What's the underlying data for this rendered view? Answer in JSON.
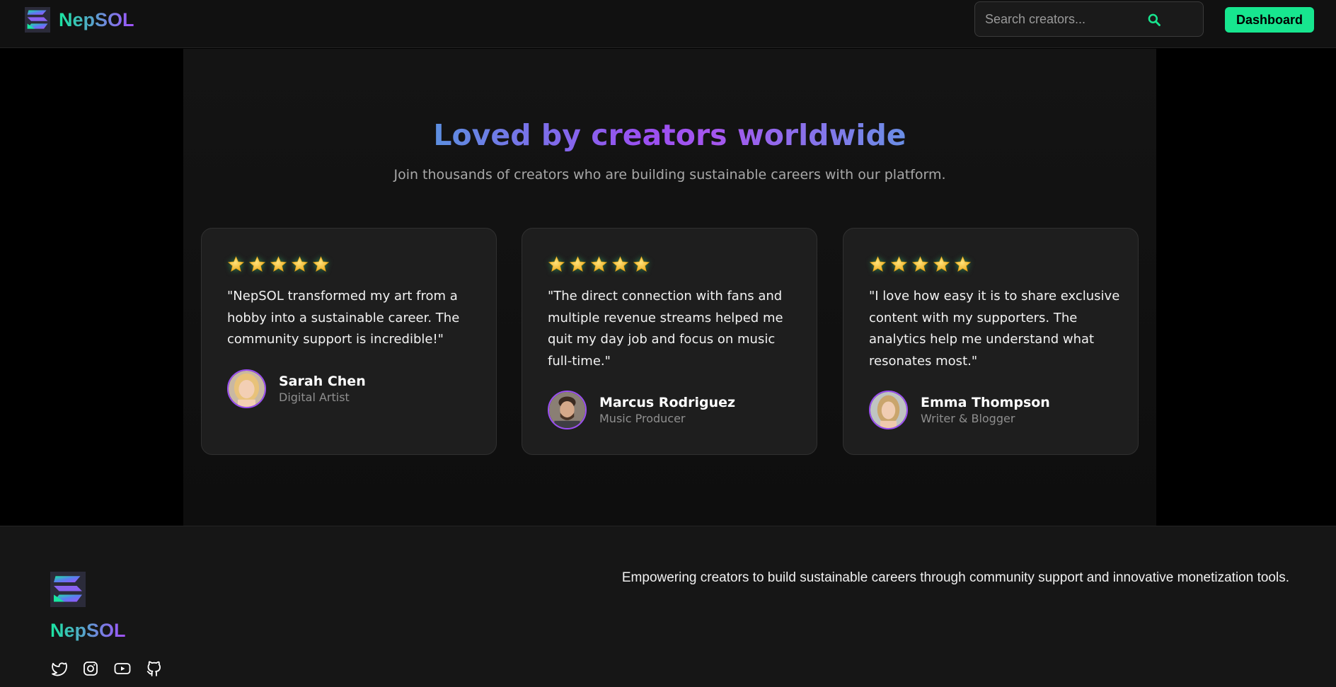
{
  "header": {
    "brand": "NepSOL",
    "search_placeholder": "Search creators...",
    "dashboard_label": "Dashboard"
  },
  "testimonials": {
    "title": "Loved by creators worldwide",
    "subtitle": "Join thousands of creators who are building sustainable careers with our platform.",
    "items": [
      {
        "quote": "\"NepSOL transformed my art from a hobby into a sustainable career. The community support is incredible!\"",
        "name": "Sarah Chen",
        "role": "Digital Artist",
        "rating": 5
      },
      {
        "quote": "\"The direct connection with fans and multiple revenue streams helped me quit my day job and focus on music full-time.\"",
        "name": "Marcus Rodriguez",
        "role": "Music Producer",
        "rating": 5
      },
      {
        "quote": "\"I love how easy it is to share exclusive content with my supporters. The analytics help me understand what resonates most.\"",
        "name": "Emma Thompson",
        "role": "Writer & Blogger",
        "rating": 5
      }
    ]
  },
  "footer": {
    "brand": "NepSOL",
    "tagline": "Empowering creators to build sustainable careers through community support and innovative monetization tools.",
    "social_icons": [
      "twitter-icon",
      "instagram-icon",
      "youtube-icon",
      "github-icon"
    ]
  },
  "colors": {
    "accent_green": "#17e68f",
    "accent_purple": "#9b4ff2",
    "star": "#f5c542"
  }
}
